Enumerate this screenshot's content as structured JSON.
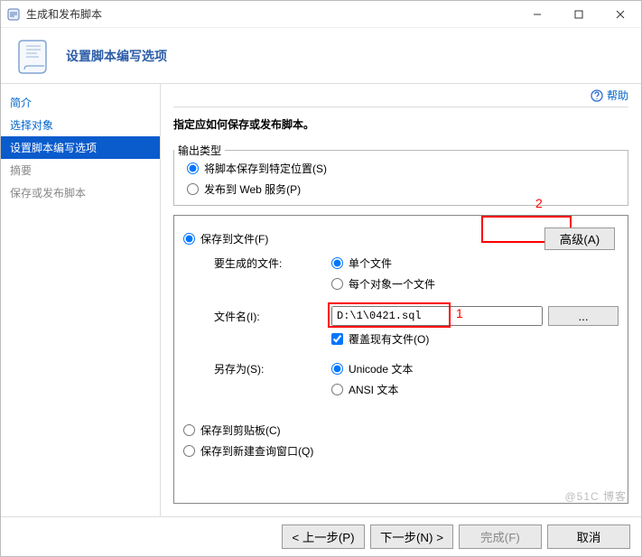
{
  "window": {
    "title": "生成和发布脚本"
  },
  "header": {
    "title": "设置脚本编写选项"
  },
  "help_label": "帮助",
  "sidebar": {
    "items": [
      {
        "label": "简介"
      },
      {
        "label": "选择对象"
      },
      {
        "label": "设置脚本编写选项"
      },
      {
        "label": "摘要"
      },
      {
        "label": "保存或发布脚本"
      }
    ]
  },
  "main": {
    "description": "指定应如何保存或发布脚本。",
    "output_type": {
      "legend": "输出类型",
      "opt_save": "将脚本保存到特定位置(S)",
      "opt_publish": "发布到 Web 服务(P)"
    },
    "save_to_file": {
      "radio_label": "保存到文件(F)",
      "advanced_btn": "高级(A)",
      "files_label": "要生成的文件:",
      "single_file": "单个文件",
      "per_object": "每个对象一个文件",
      "filename_label": "文件名(I):",
      "filename_value": "D:\\1\\0421.sql",
      "browse_btn": "...",
      "overwrite": "覆盖现有文件(O)",
      "save_as_label": "另存为(S):",
      "unicode": "Unicode 文本",
      "ansi": "ANSI 文本",
      "clipboard": "保存到剪贴板(C)",
      "new_query": "保存到新建查询窗口(Q)"
    },
    "annotations": {
      "a1": "1",
      "a2": "2"
    }
  },
  "footer": {
    "back": "< 上一步(P)",
    "next": "下一步(N) >",
    "finish": "完成(F)",
    "cancel": "取消"
  },
  "watermark": "@51C 博客"
}
